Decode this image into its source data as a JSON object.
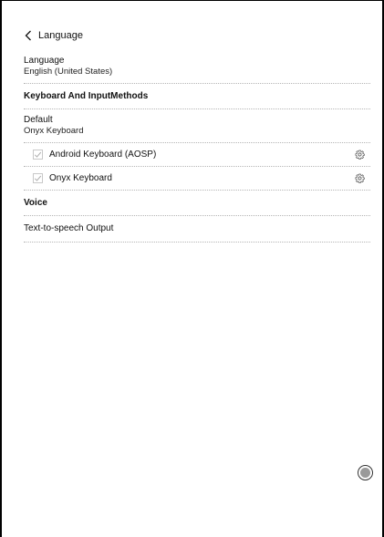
{
  "header": {
    "back_label": "Language"
  },
  "language": {
    "title": "Language",
    "summary": "English (United States)"
  },
  "keyboard_section": {
    "header": "Keyboard And InputMethods",
    "default_title": "Default",
    "default_summary": "Onyx Keyboard",
    "items": [
      {
        "label": "Android Keyboard (AOSP)",
        "checked": true
      },
      {
        "label": "Onyx Keyboard",
        "checked": true
      }
    ]
  },
  "voice_section": {
    "header": "Voice",
    "tts_label": "Text-to-speech Output"
  },
  "icons": {
    "back": "chevron-left-icon",
    "checkbox": "checkmark-icon",
    "settings": "gear-icon",
    "floating": "floating-ball-icon"
  },
  "colors": {
    "checkbox_border": "#c8c8c8",
    "check_mark": "#b0b0b0",
    "divider": "#b5b5b5",
    "float_inner": "#9a9a9a"
  }
}
